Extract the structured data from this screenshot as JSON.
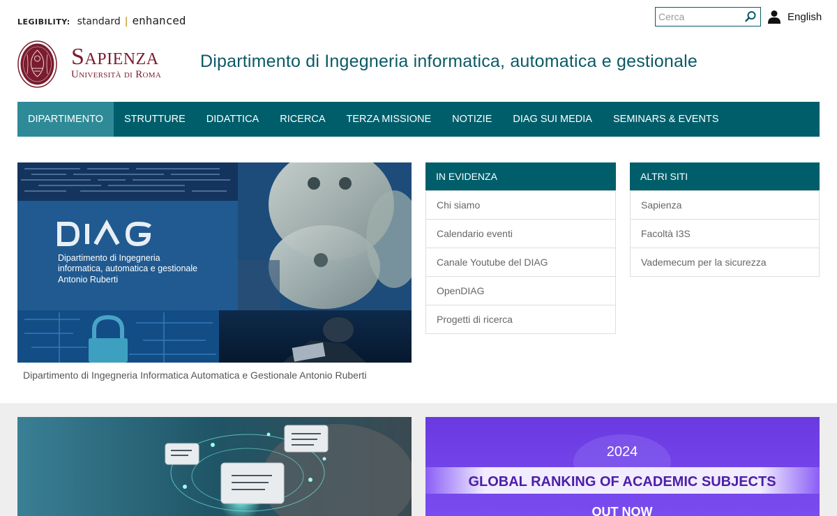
{
  "legibility": {
    "label": "LEGIBILITY:",
    "standard": "standard",
    "separator": "|",
    "enhanced": "enhanced"
  },
  "search": {
    "placeholder": "Cerca"
  },
  "language": {
    "label": "English"
  },
  "brand": {
    "name": "Sapienza",
    "subtitle": "Università di Roma",
    "seal_text": "STVDIVM VRBIS"
  },
  "header": {
    "title": "Dipartimento di Ingegneria informatica, automatica e gestionale"
  },
  "nav": {
    "items": [
      {
        "label": "DIPARTIMENTO",
        "active": true
      },
      {
        "label": "STRUTTURE",
        "active": false
      },
      {
        "label": "DIDATTICA",
        "active": false
      },
      {
        "label": "RICERCA",
        "active": false
      },
      {
        "label": "TERZA MISSIONE",
        "active": false
      },
      {
        "label": "NOTIZIE",
        "active": false
      },
      {
        "label": "DIAG SUI MEDIA",
        "active": false
      },
      {
        "label": "SEMINARS & EVENTS",
        "active": false
      }
    ]
  },
  "hero": {
    "logo_text": "DIAG",
    "image_line1": "Dipartimento di Ingegneria",
    "image_line2": "informatica, automatica e gestionale",
    "image_line3": "Antonio Ruberti",
    "caption": "Dipartimento di Ingegneria Informatica Automatica e Gestionale Antonio Ruberti"
  },
  "in_evidenza": {
    "title": "IN EVIDENZA",
    "items": [
      "Chi siamo",
      "Calendario eventi",
      "Canale Youtube del DIAG",
      "OpenDIAG",
      "Progetti di ricerca"
    ]
  },
  "altri_siti": {
    "title": "ALTRI SITI",
    "items": [
      "Sapienza",
      "Facoltà I3S",
      "Vademecum per la sicurezza"
    ]
  },
  "cards": {
    "ranking_year": "2024",
    "ranking_title": "GLOBAL RANKING OF ACADEMIC SUBJECTS",
    "ranking_out": "OUT NOW"
  },
  "colors": {
    "teal": "#005e6b",
    "teal_active": "#2e8a96",
    "brand_red": "#7a1c2e"
  }
}
